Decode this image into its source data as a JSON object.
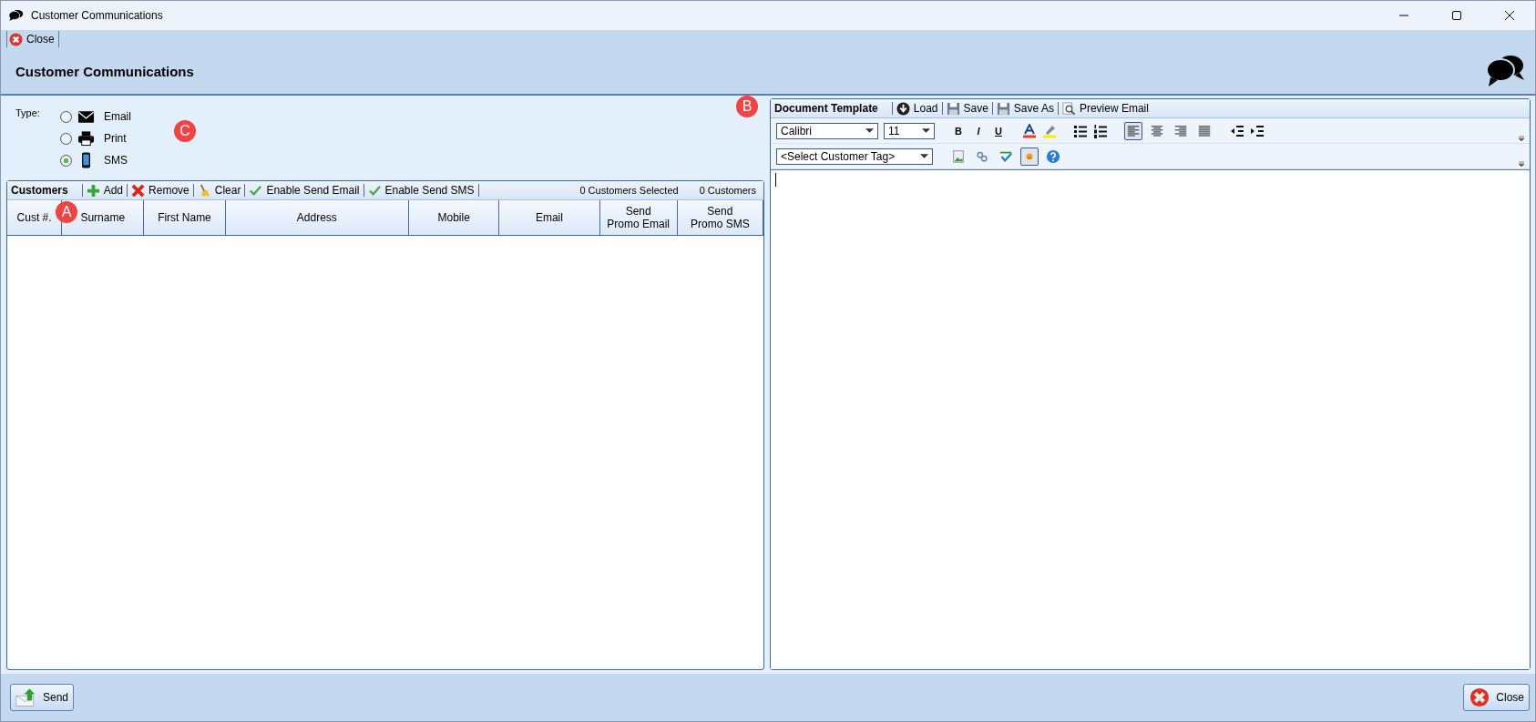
{
  "window": {
    "title": "Customer Communications"
  },
  "toolbar": {
    "close_label": "Close"
  },
  "header": {
    "title": "Customer Communications"
  },
  "type": {
    "label": "Type:",
    "options": [
      {
        "label": "Email",
        "kind": "envelope",
        "selected": false
      },
      {
        "label": "Print",
        "kind": "printer",
        "selected": false
      },
      {
        "label": "SMS",
        "kind": "phone",
        "selected": true
      }
    ]
  },
  "customers": {
    "title": "Customers",
    "actions": [
      {
        "label": "Add",
        "kind": "add"
      },
      {
        "label": "Remove",
        "kind": "remove"
      },
      {
        "label": "Clear",
        "kind": "clear"
      },
      {
        "label": "Enable Send Email",
        "kind": "check"
      },
      {
        "label": "Enable Send SMS",
        "kind": "check"
      }
    ],
    "selected_count": "0 Customers Selected",
    "total": "0 Customers",
    "columns": [
      "Cust #.",
      "Surname",
      "First Name",
      "Address",
      "Mobile",
      "Email",
      "Send\nPromo Email",
      "Send\nPromo SMS"
    ]
  },
  "template": {
    "title": "Document Template",
    "actions": [
      {
        "label": "Load",
        "kind": "load"
      },
      {
        "label": "Save",
        "kind": "save"
      },
      {
        "label": "Save As",
        "kind": "save"
      },
      {
        "label": "Preview Email",
        "kind": "preview"
      }
    ],
    "font": "Calibri",
    "size": "11",
    "format": [
      {
        "kind": "bold",
        "label": "B"
      },
      {
        "kind": "italic",
        "label": "I"
      },
      {
        "kind": "underline",
        "label": "U"
      }
    ],
    "align": [
      {
        "kind": "left",
        "selected": true
      },
      {
        "kind": "center",
        "selected": false
      },
      {
        "kind": "right",
        "selected": false
      },
      {
        "kind": "justify",
        "selected": false
      }
    ],
    "tag": "<Select Customer Tag>",
    "insert_tools": [
      {
        "kind": "image",
        "selected": false
      },
      {
        "kind": "link",
        "selected": false
      },
      {
        "kind": "spellcheck",
        "selected": false
      },
      {
        "kind": "emoji",
        "selected": true
      },
      {
        "kind": "help",
        "selected": false
      }
    ]
  },
  "footer": {
    "send_label": "Send",
    "close_label": "Close"
  },
  "markers": [
    "A",
    "B",
    "C"
  ]
}
